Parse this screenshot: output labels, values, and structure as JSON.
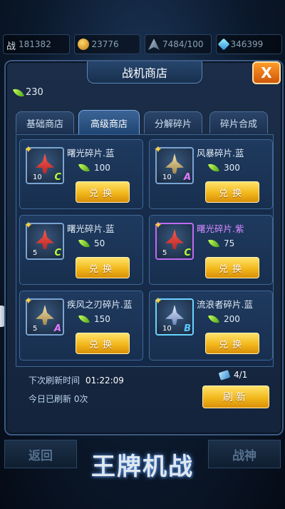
{
  "topbar": {
    "power": {
      "label": "战",
      "value": "181382"
    },
    "coins": "23776",
    "fleet": "7484/100",
    "gems": "346399"
  },
  "panel": {
    "title": "战机商店",
    "close": "X",
    "currency": "230"
  },
  "tabs": [
    {
      "label": "基础商店"
    },
    {
      "label": "高级商店",
      "active": true
    },
    {
      "label": "分解碎片"
    },
    {
      "label": "碎片合成"
    }
  ],
  "items": [
    {
      "name": "曙光碎片.蓝",
      "price": "100",
      "qty": "10",
      "grade": "C",
      "button": "兑换"
    },
    {
      "name": "风暴碎片.蓝",
      "price": "300",
      "qty": "10",
      "grade": "A",
      "button": "兑换"
    },
    {
      "name": "曙光碎片.蓝",
      "price": "50",
      "qty": "5",
      "grade": "C",
      "button": "兑换"
    },
    {
      "name": "曙光碎片.紫",
      "price": "75",
      "qty": "5",
      "grade": "C",
      "button": "兑换"
    },
    {
      "name": "疾风之刃碎片.蓝",
      "price": "150",
      "qty": "5",
      "grade": "A",
      "button": "兑换"
    },
    {
      "name": "流浪者碎片.蓝",
      "price": "200",
      "qty": "10",
      "grade": "B",
      "button": "兑换"
    }
  ],
  "footer": {
    "next_refresh_label": "下次刷新时间",
    "next_refresh_time": "01:22:09",
    "refreshed_today": "今日已刷新 0次",
    "tickets": "4/1",
    "refresh_button": "刷新"
  },
  "bottom": {
    "back": "返回",
    "battle": "战神",
    "logo": "王牌机战"
  },
  "colors": {
    "accent_gold": "#f2b81c",
    "grade_c": "#b6ff3c",
    "grade_a": "#e07bff",
    "grade_b": "#58c8ff"
  }
}
